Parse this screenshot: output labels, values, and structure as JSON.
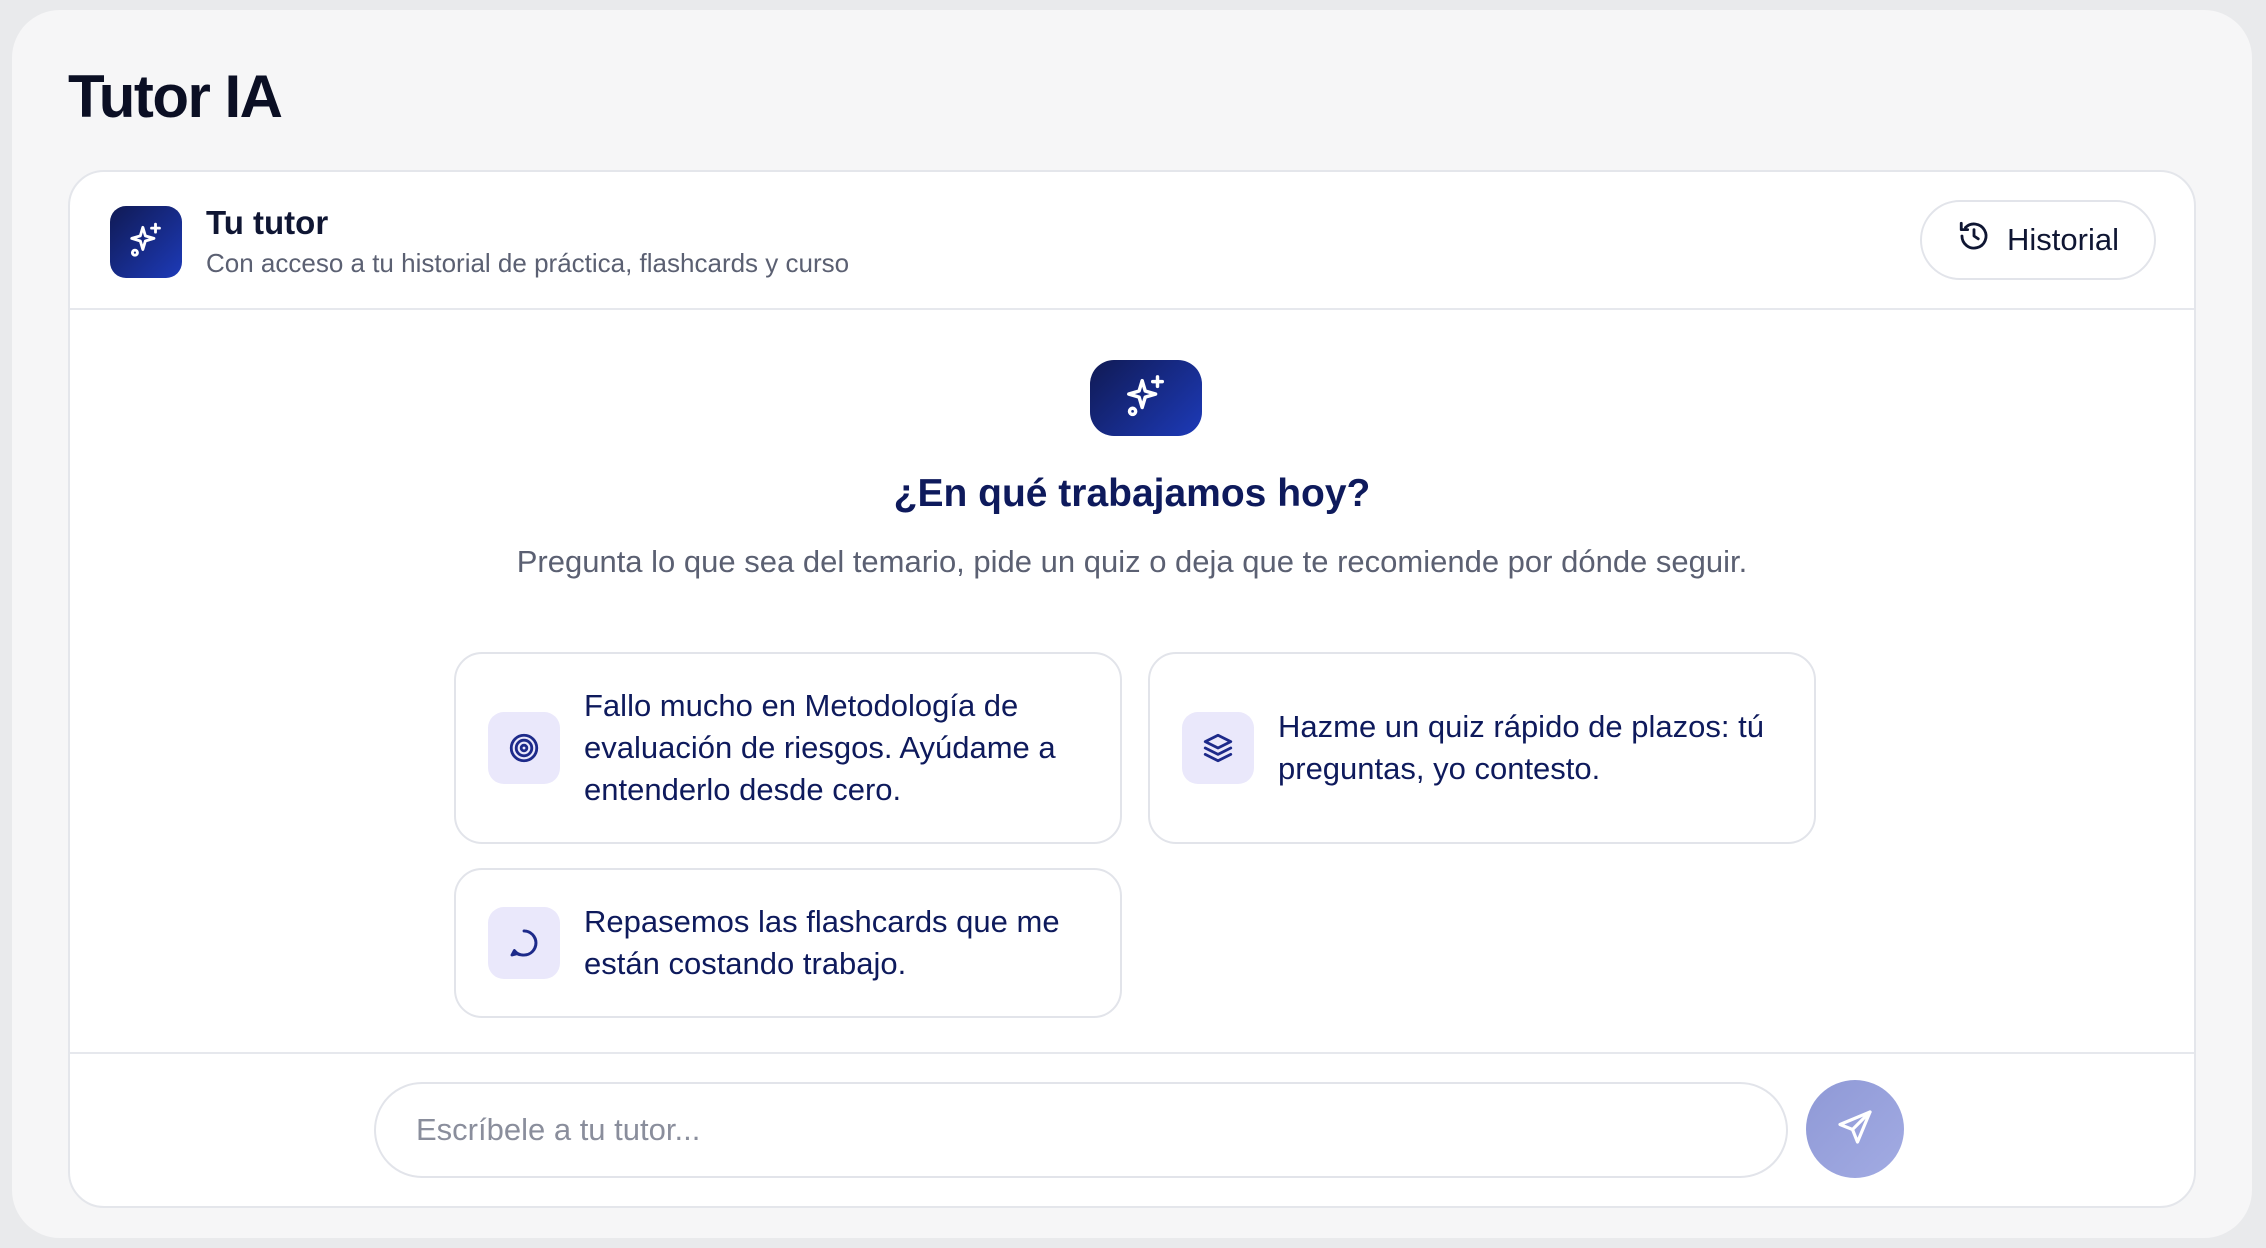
{
  "page": {
    "title": "Tutor IA"
  },
  "header": {
    "tutor_name": "Tu tutor",
    "tutor_description": "Con acceso a tu historial de práctica, flashcards y curso",
    "history_label": "Historial",
    "avatar_icon": "sparkles-icon",
    "history_icon": "history-icon"
  },
  "hero": {
    "icon": "sparkles-icon",
    "title": "¿En qué trabajamos hoy?",
    "subtitle": "Pregunta lo que sea del temario, pide un quiz o deja que te recomiende por dónde seguir."
  },
  "suggestions": [
    {
      "icon": "target-icon",
      "text": "Fallo mucho en Metodología de evaluación de riesgos. Ayúdame a entenderlo desde cero."
    },
    {
      "icon": "layers-icon",
      "text": "Hazme un quiz rápido de plazos: tú preguntas, yo contesto."
    },
    {
      "icon": "chat-bubble-icon",
      "text": "Repasemos las flashcards que me están costando trabajo."
    }
  ],
  "composer": {
    "placeholder": "Escríbele a tu tutor...",
    "value": "",
    "send_icon": "send-icon"
  },
  "colors": {
    "brand_dark": "#101a54",
    "brand": "#1d3ab8",
    "text_primary": "#0e1a5c",
    "icon_bg": "#eae8fb",
    "send_disabled": "#9aa3de"
  }
}
